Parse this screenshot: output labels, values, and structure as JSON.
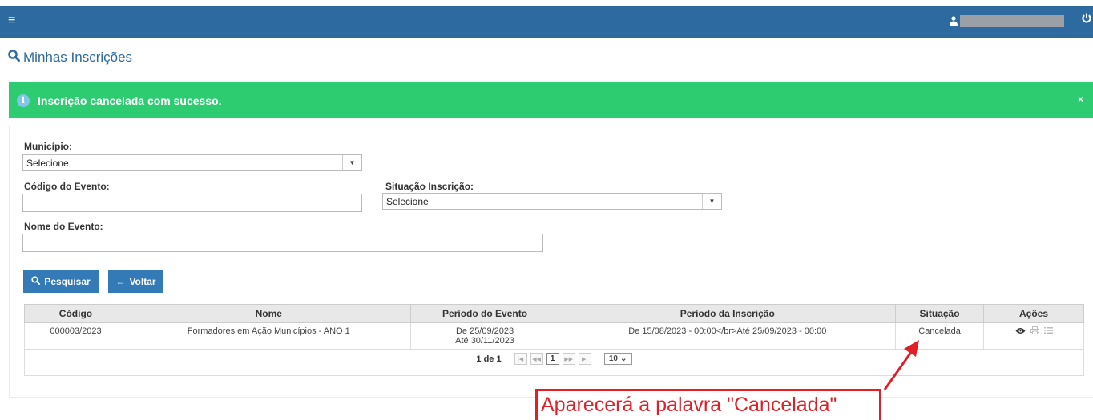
{
  "topbar": {
    "menu_icon": "hamburger-icon",
    "user_icon": "user-icon",
    "power_icon": "power-icon",
    "bg_color": "#2d6a9f"
  },
  "page": {
    "title": "Minhas Inscrições",
    "title_icon": "search-icon"
  },
  "alert": {
    "message": "Inscrição cancelada com sucesso.",
    "close": "×",
    "color": "#2ecc71"
  },
  "filters": {
    "municipio_label": "Município:",
    "municipio_value": "Selecione",
    "codigo_label": "Código do Evento:",
    "codigo_value": "",
    "situacao_label": "Situação Inscrição:",
    "situacao_value": "Selecione",
    "nome_label": "Nome do Evento:",
    "nome_value": ""
  },
  "buttons": {
    "pesquisar": "Pesquisar",
    "voltar": "Voltar"
  },
  "table": {
    "headers": [
      "Código",
      "Nome",
      "Período do Evento",
      "Período da Inscrição",
      "Situação",
      "Ações"
    ],
    "rows": [
      {
        "codigo": "000003/2023",
        "nome": "Formadores em Ação Municípios - ANO 1",
        "periodo_evento_de": "De 25/09/2023",
        "periodo_evento_ate": "Até 30/11/2023",
        "periodo_inscricao": "De 15/08/2023 - 00:00</br>Até 25/09/2023 - 00:00",
        "situacao": "Cancelada"
      }
    ],
    "pager": {
      "info": "1 de 1",
      "current_page": "1",
      "page_size": "10"
    }
  },
  "annotation": {
    "text": "Aparecerá a palavra \"Cancelada\"",
    "color": "#e21f26"
  }
}
